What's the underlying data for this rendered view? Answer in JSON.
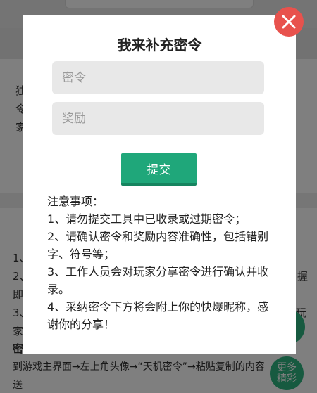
{
  "modal": {
    "title": "我来补充密令",
    "password_placeholder": "密令",
    "reward_placeholder": "奖励",
    "submit_label": "提交",
    "notes_heading": "注意事项：",
    "notes": [
      "1、请勿提交工具中已收录或过期密令；",
      "2、请确认密令和奖励内容准确性，包括错别字、符号等；",
      "3、工作人员会对玩家分享密令进行确认并收录。",
      "4、采纳密令下方将会附上你的快爆昵称，感谢你的分享！"
    ],
    "close_icon": "close-icon"
  },
  "background": {
    "card_lines": [
      "独",
      "令",
      "家"
    ],
    "list_lines": [
      "1、",
      "2、",
      "即",
      "3、",
      "家"
    ],
    "right_fragments": [
      "握",
      "玩"
    ],
    "section_label": "密",
    "instruction": "到游戏主界面→左上角头像→“天机密令”→粘贴复制的内容",
    "instruction_tail": "送",
    "float_button": "更多精彩"
  },
  "colors": {
    "accent": "#1fa77a",
    "close": "#e8524d",
    "overlay": "rgba(0,0,0,0.5)"
  }
}
